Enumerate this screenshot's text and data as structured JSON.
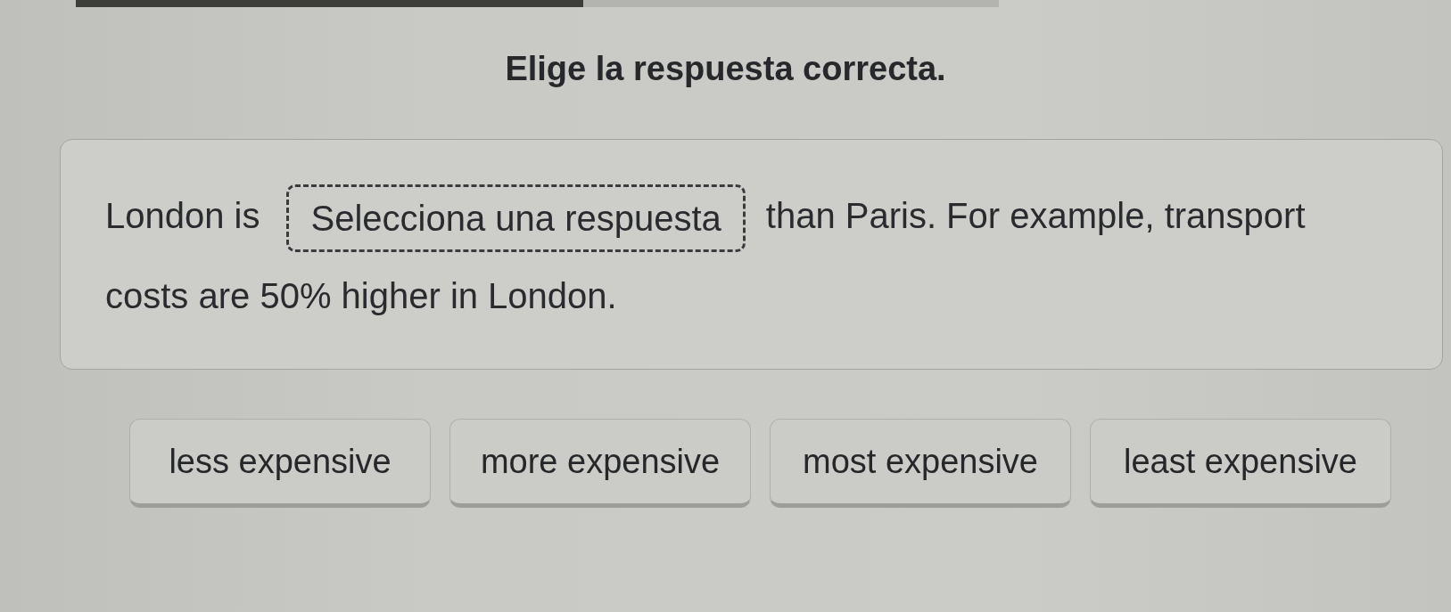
{
  "progress": {
    "level": 0.55
  },
  "instruction": "Elige la respuesta correcta.",
  "sentence": {
    "before": "London is",
    "blank": {
      "placeholder": "Selecciona una respuesta"
    },
    "after": "than Paris. For example, transport costs are 50% higher in London."
  },
  "options": [
    {
      "label": "less expensive",
      "selected": false
    },
    {
      "label": "more expensive",
      "selected": false
    },
    {
      "label": "most expensive",
      "selected": false
    },
    {
      "label": "least expensive",
      "selected": false
    }
  ]
}
